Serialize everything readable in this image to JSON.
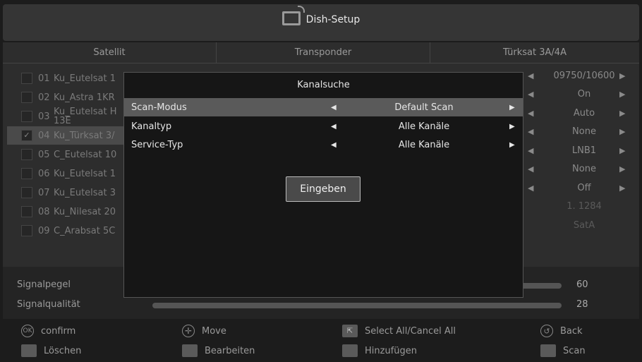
{
  "header": {
    "title": "Dish-Setup",
    "icon": "tv-icon"
  },
  "columns": {
    "satellite": "Satellit",
    "transponder": "Transponder",
    "selected_satellite": "Türksat 3A/4A"
  },
  "satellites": [
    {
      "num": "01",
      "name": "Ku_Eutelsat 1",
      "checked": false
    },
    {
      "num": "02",
      "name": "Ku_Astra 1KR",
      "checked": false
    },
    {
      "num": "03",
      "name": "Ku_Eutelsat H",
      "name2": "13E",
      "checked": false
    },
    {
      "num": "04",
      "name": "Ku_Türksat 3/",
      "checked": true
    },
    {
      "num": "05",
      "name": "C_Eutelsat 10",
      "checked": false
    },
    {
      "num": "06",
      "name": "Ku_Eutelsat 1",
      "checked": false
    },
    {
      "num": "07",
      "name": "Ku_Eutelsat 3",
      "checked": false
    },
    {
      "num": "08",
      "name": "Ku_Nilesat 20",
      "checked": false
    },
    {
      "num": "09",
      "name": "C_Arabsat 5C",
      "checked": false
    }
  ],
  "params": [
    {
      "value": "09750/10600",
      "arrows": true
    },
    {
      "value": "On",
      "arrows": true
    },
    {
      "value": "Auto",
      "arrows": true
    },
    {
      "value": "None",
      "arrows": true
    },
    {
      "value": "LNB1",
      "arrows": true
    },
    {
      "value": "None",
      "arrows": true
    },
    {
      "value": "Off",
      "arrows": true
    },
    {
      "value": "1. 1284",
      "arrows": false
    },
    {
      "value": "SatA",
      "arrows": false
    }
  ],
  "signal": {
    "level_label": "Signalpegel",
    "level_value": "60",
    "quality_label": "Signalqualität",
    "quality_value": "28"
  },
  "footer": {
    "confirm": "confirm",
    "ok_icon_text": "OK",
    "move": "Move",
    "select_all": "Select All/Cancel All",
    "back": "Back",
    "delete": "Löschen",
    "edit": "Bearbeiten",
    "add": "Hinzufügen",
    "scan": "Scan"
  },
  "dialog": {
    "title": "Kanalsuche",
    "rows": [
      {
        "label": "Scan-Modus",
        "value": "Default Scan"
      },
      {
        "label": "Kanaltyp",
        "value": "Alle Kanäle"
      },
      {
        "label": "Service-Typ",
        "value": "Alle Kanäle"
      }
    ],
    "button": "Eingeben"
  },
  "glyphs": {
    "left": "◀",
    "right": "▶",
    "check": "✓"
  }
}
